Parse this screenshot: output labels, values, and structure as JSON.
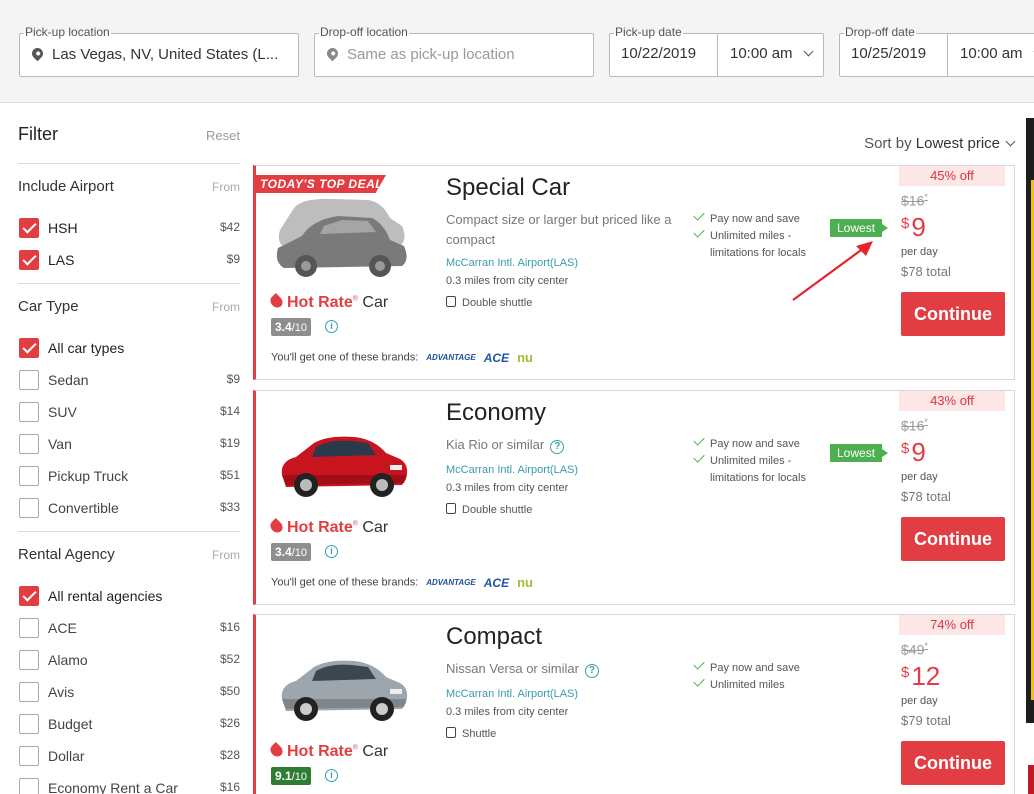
{
  "search": {
    "pickup_location": {
      "label": "Pick-up location",
      "value": "Las Vegas, NV, United States (L..."
    },
    "dropoff_location": {
      "label": "Drop-off location",
      "placeholder": "Same as pick-up location"
    },
    "pickup_date": {
      "label": "Pick-up date",
      "date": "10/22/2019",
      "time": "10:00 am"
    },
    "dropoff_date": {
      "label": "Drop-off date",
      "date": "10/25/2019",
      "time": "10:00 am"
    }
  },
  "filter": {
    "title": "Filter",
    "reset": "Reset",
    "airport": {
      "title": "Include Airport",
      "from": "From",
      "options": [
        {
          "label": "HSH",
          "price": "$42",
          "checked": true
        },
        {
          "label": "LAS",
          "price": "$9",
          "checked": true
        }
      ]
    },
    "car_type": {
      "title": "Car Type",
      "from": "From",
      "options": [
        {
          "label": "All car types",
          "price": "",
          "checked": true
        },
        {
          "label": "Sedan",
          "price": "$9",
          "checked": false
        },
        {
          "label": "SUV",
          "price": "$14",
          "checked": false
        },
        {
          "label": "Van",
          "price": "$19",
          "checked": false
        },
        {
          "label": "Pickup Truck",
          "price": "$51",
          "checked": false
        },
        {
          "label": "Convertible",
          "price": "$33",
          "checked": false
        }
      ]
    },
    "agency": {
      "title": "Rental Agency",
      "from": "From",
      "options": [
        {
          "label": "All rental agencies",
          "price": "",
          "checked": true
        },
        {
          "label": "ACE",
          "price": "$16",
          "checked": false
        },
        {
          "label": "Alamo",
          "price": "$52",
          "checked": false
        },
        {
          "label": "Avis",
          "price": "$50",
          "checked": false
        },
        {
          "label": "Budget",
          "price": "$26",
          "checked": false
        },
        {
          "label": "Dollar",
          "price": "$28",
          "checked": false
        },
        {
          "label": "Economy Rent a Car",
          "price": "$16",
          "checked": false
        }
      ]
    }
  },
  "sort": {
    "prefix": "Sort by",
    "value": "Lowest price"
  },
  "cards": [
    {
      "deal": "TODAY'S TOP DEAL",
      "title": "Special Car",
      "desc": "Compact size or larger but priced like a compact",
      "location": "McCarran Intl. Airport(LAS)",
      "distance": "0.3 miles from city center",
      "shuttle": "Double shuttle",
      "perks": [
        "Pay now and save",
        "Unlimited miles -",
        "limitations for locals"
      ],
      "badge": "Lowest",
      "discount": "45% off",
      "original": "$16",
      "original_mark": "*",
      "currency": "$",
      "price": "9",
      "per_day": "per day",
      "total": "$78 total",
      "cta": "Continue",
      "hotrate_brand": "Hot Rate",
      "hotrate_reg": "®",
      "hotrate_suffix": "Car",
      "rating": "3.4",
      "rating_max": "/10",
      "brands_text": "You'll get one of these brands:",
      "brand_names": [
        "ADVANTAGE",
        "ACE",
        "nu"
      ]
    },
    {
      "title": "Economy",
      "desc": "Kia Rio or similar",
      "location": "McCarran Intl. Airport(LAS)",
      "distance": "0.3 miles from city center",
      "shuttle": "Double shuttle",
      "perks": [
        "Pay now and save",
        "Unlimited miles -",
        "limitations for locals"
      ],
      "badge": "Lowest",
      "discount": "43% off",
      "original": "$16",
      "original_mark": "*",
      "currency": "$",
      "price": "9",
      "per_day": "per day",
      "total": "$78 total",
      "cta": "Continue",
      "hotrate_brand": "Hot Rate",
      "hotrate_reg": "®",
      "hotrate_suffix": "Car",
      "rating": "3.4",
      "rating_max": "/10",
      "brands_text": "You'll get one of these brands:",
      "brand_names": [
        "ADVANTAGE",
        "ACE",
        "nu"
      ]
    },
    {
      "title": "Compact",
      "desc": "Nissan Versa or similar",
      "location": "McCarran Intl. Airport(LAS)",
      "distance": "0.3 miles from city center",
      "shuttle": "Shuttle",
      "perks": [
        "Pay now and save",
        "Unlimited miles"
      ],
      "discount": "74% off",
      "original": "$49",
      "original_mark": "*",
      "currency": "$",
      "price": "12",
      "per_day": "per day",
      "total": "$79 total",
      "cta": "Continue",
      "hotrate_brand": "Hot Rate",
      "hotrate_reg": "®",
      "hotrate_suffix": "Car",
      "rating": "9.1",
      "rating_max": "/10"
    }
  ],
  "colors": {
    "accent": "#e33d44",
    "lowest": "#4caf50",
    "link": "#3a9ab3"
  }
}
